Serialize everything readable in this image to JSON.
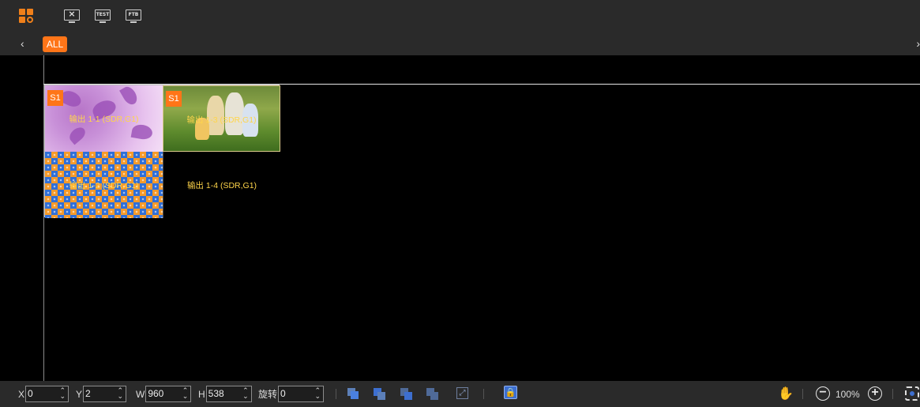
{
  "toolbar": {
    "icons": [
      "layout-apps-icon",
      "clear-screen-icon",
      "test-pattern-icon",
      "ftb-icon"
    ],
    "clear_label": "×",
    "test_label": "TEST",
    "ftb_label": "FTB"
  },
  "layerbar": {
    "prev": "‹",
    "next": "›",
    "tab_all": "ALL"
  },
  "outputs": [
    {
      "label": "输出 1-1 (SDR,G1)",
      "badge": "S1"
    },
    {
      "label": "输出 1-3 (SDR,G1)",
      "badge": "S1"
    },
    {
      "label": "输出 1-2 (SDR,G1)",
      "badge": ""
    },
    {
      "label": "输出 1-4 (SDR,G1)",
      "badge": ""
    }
  ],
  "bottombar": {
    "x_label": "X",
    "x_value": "0",
    "y_label": "Y",
    "y_value": "2",
    "w_label": "W",
    "w_value": "960",
    "h_label": "H",
    "h_value": "538",
    "rotate_label": "旋转",
    "rotate_value": "0",
    "spin": "⌃⌄",
    "zoom": "100%",
    "zoom_out": "−",
    "zoom_in": "+",
    "lock": "🔒",
    "hand": "✋",
    "resize": "⤢"
  },
  "colors": {
    "accent": "#ff7518",
    "label": "#ffd54a",
    "arrange": "#3d6fd0"
  }
}
